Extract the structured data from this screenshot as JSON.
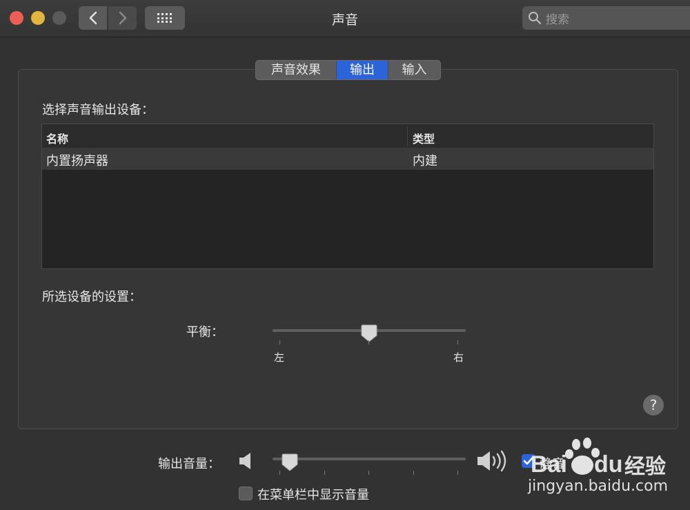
{
  "window": {
    "title": "声音"
  },
  "search": {
    "placeholder": "搜索"
  },
  "tabs": [
    {
      "label": "声音效果",
      "selected": false
    },
    {
      "label": "输出",
      "selected": true
    },
    {
      "label": "输入",
      "selected": false
    }
  ],
  "output": {
    "select_label": "选择声音输出设备：",
    "columns": [
      "名称",
      "类型"
    ],
    "devices": [
      {
        "name": "内置扬声器",
        "type": "内建"
      }
    ],
    "settings_label": "所选设备的设置：",
    "balance": {
      "label": "平衡：",
      "left": "左",
      "right": "右",
      "value": 0.5
    }
  },
  "help": "?",
  "volume": {
    "label": "输出音量：",
    "level": 0.09,
    "mute_label": "静音",
    "mute_checked": true
  },
  "menubar_option": {
    "label": "在菜单栏中显示音量",
    "checked": false
  },
  "watermark": {
    "brand": "Bai du 经验",
    "url": "jingyan.baidu.com"
  },
  "colors": {
    "accent": "#2d63d8",
    "background": "#323232"
  }
}
